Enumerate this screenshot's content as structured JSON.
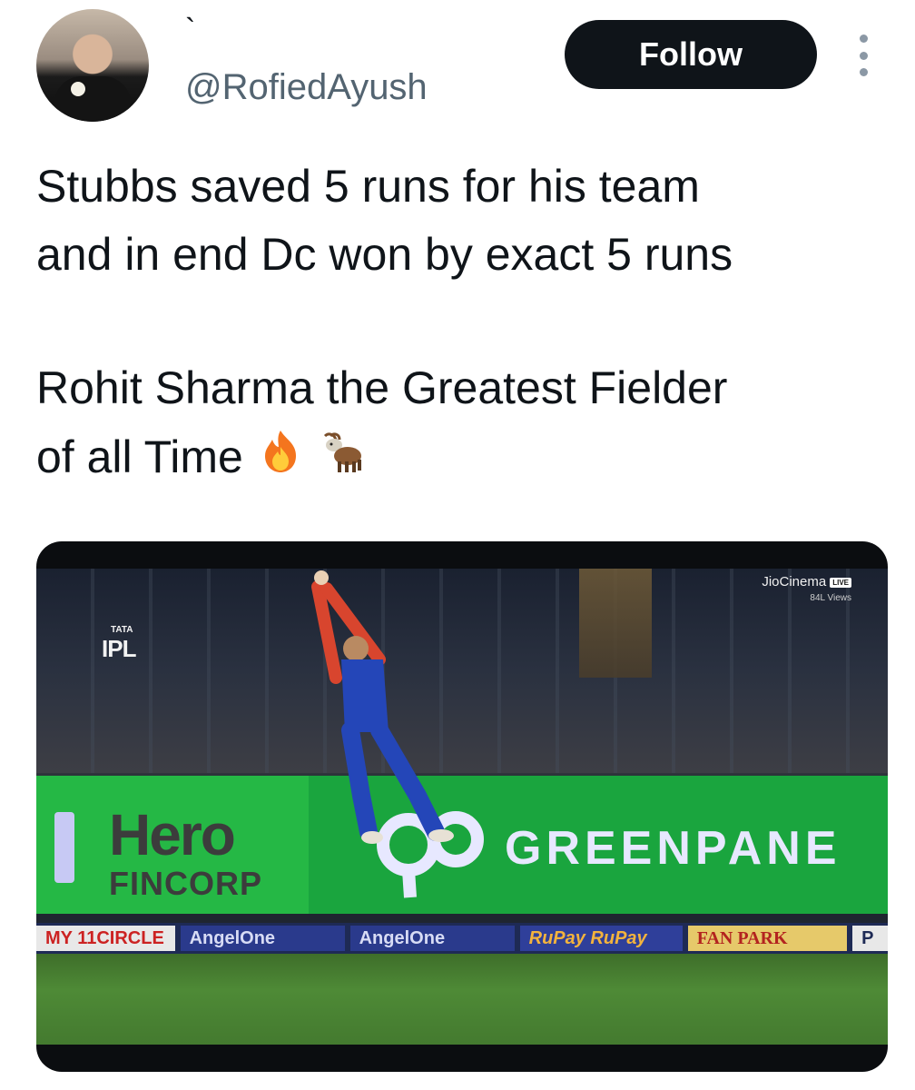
{
  "author": {
    "display_name": "`",
    "handle": "@RofiedAyush"
  },
  "follow_label": "Follow",
  "more_icon": "more-options-icon",
  "tweet": {
    "line1": "Stubbs saved 5 runs for his team",
    "line2": "and in end Dc won by exact 5 runs",
    "line3": "Rohit Sharma the Greatest Fielder",
    "line4": "of all Time",
    "emojis": [
      "fire-emoji",
      "goat-emoji"
    ]
  },
  "media": {
    "ipl_logo": {
      "tata": "TATA",
      "word": "IPL"
    },
    "broadcaster": {
      "name": "JioCinema",
      "live": "LIVE",
      "views": "84L Views"
    },
    "board": {
      "hero_word": "Hero",
      "hero_sub": "FINCORP",
      "greenpanel": "GREENPANE"
    },
    "sponsors": [
      "MY 11CIRCLE",
      "AngelOne",
      "AngelOne",
      "RuPay RuPay",
      "FAN PARK",
      "P"
    ]
  },
  "colors": {
    "follow_bg": "#0f1419",
    "handle": "#536471",
    "board_green": "#1aa53e"
  }
}
